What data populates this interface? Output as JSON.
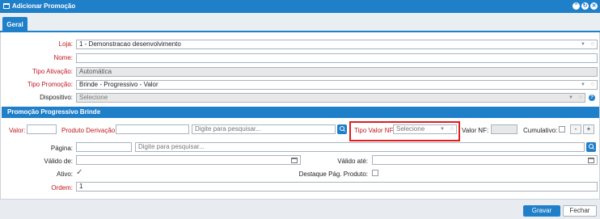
{
  "window": {
    "title": "Adicionar Promoção"
  },
  "tabs": [
    {
      "label": "Geral"
    }
  ],
  "form": {
    "loja": {
      "label": "Loja:",
      "value": "1 - Demonstracao desenvolvimento"
    },
    "nome": {
      "label": "Nome:",
      "value": ""
    },
    "tipo_ativacao": {
      "label": "Tipo Ativação:",
      "value": "Automática"
    },
    "tipo_promocao": {
      "label": "Tipo Promoção:",
      "value": "Brinde - Progressivo - Valor"
    },
    "dispositivo": {
      "label": "Dispositivo:",
      "placeholder": "Selecione"
    }
  },
  "section": {
    "title": "Promoção Progressivo Brinde",
    "valor_label": "Valor:",
    "produto_derivacao_label": "Produto Derivação:",
    "produto_search_placeholder": "Digite para pesquisar...",
    "tipo_valor_nf_label": "Tipo Valor NF:",
    "tipo_valor_nf_placeholder": "Selecione",
    "valor_nf_label": "Valor NF:",
    "cumulativo_label": "Cumulativo:",
    "minus_label": "-",
    "plus_label": "+"
  },
  "lower": {
    "pagina_label": "Página:",
    "pagina_search_placeholder": "Digite para pesquisar...",
    "valido_de_label": "Válido de:",
    "valido_ate_label": "Válido até:",
    "ativo_label": "Ativo:",
    "destaque_label": "Destaque Pág. Produto:",
    "ordem_label": "Ordem:",
    "ordem_value": "1"
  },
  "footer": {
    "gravar_label": "Gravar",
    "fechar_label": "Fechar"
  },
  "colors": {
    "accent": "#1f7fc9",
    "required": "#c0181f",
    "highlight": "#e01d1d"
  }
}
